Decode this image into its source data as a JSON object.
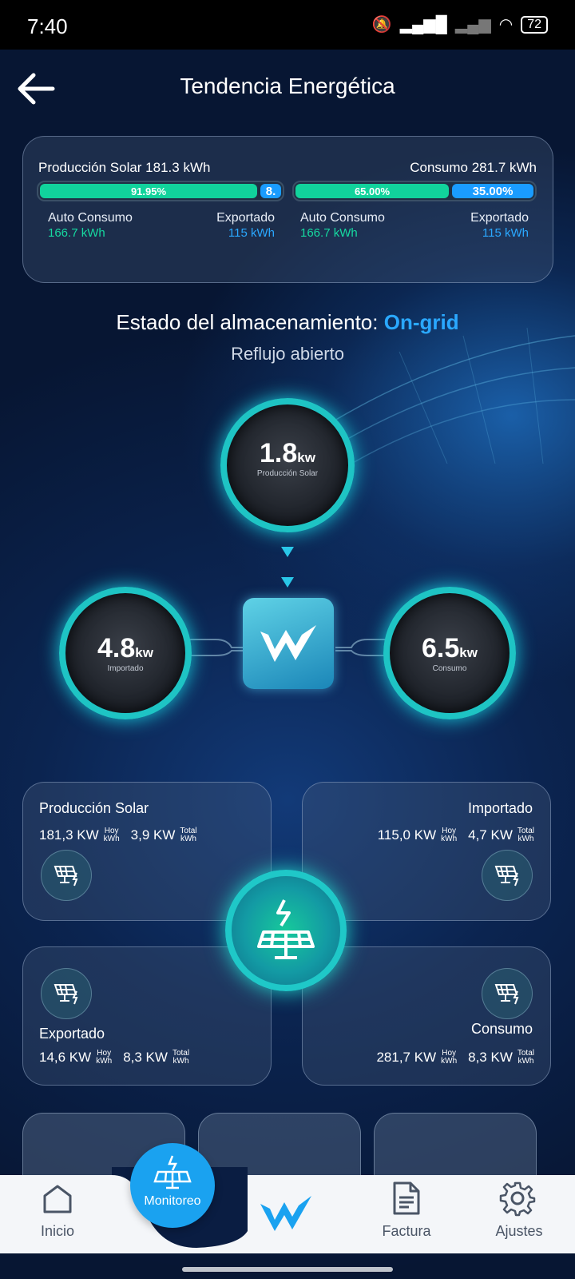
{
  "status": {
    "time": "7:40",
    "battery": "72"
  },
  "header": {
    "title": "Tendencia Energética"
  },
  "summary": {
    "solar_label": "Producción Solar 181.3 kWh",
    "consumo_label": "Consumo 281.7 kWh",
    "bar1": {
      "green_pct": "91.95%",
      "blue_pct": "8.",
      "green_fraction": 0.9195
    },
    "bar2": {
      "green_pct": "65.00%",
      "blue_pct": "35.00%",
      "green_fraction": 0.65
    },
    "left": {
      "auto_label": "Auto Consumo",
      "auto_value": "166.7 kWh",
      "exp_label": "Exportado",
      "exp_value": "115 kWh"
    },
    "right": {
      "auto_label": "Auto Consumo",
      "auto_value": "166.7 kWh",
      "exp_label": "Exportado",
      "exp_value": "115 kWh"
    }
  },
  "storage": {
    "prefix": "Estado del almacenamiento: ",
    "state": "On-grid",
    "sub": "Reflujo abierto"
  },
  "flow": {
    "solar": {
      "value": "1.8",
      "unit": "kw",
      "caption": "Producción Solar"
    },
    "import": {
      "value": "4.8",
      "unit": "kw",
      "caption": "Importado"
    },
    "consumo": {
      "value": "6.5",
      "unit": "kw",
      "caption": "Consumo"
    }
  },
  "cards": {
    "solar": {
      "title": "Producción Solar",
      "v1": "181,3 KW",
      "u1a": "Hoy",
      "u1b": "kWh",
      "v2": "3,9 KW",
      "u2a": "Total",
      "u2b": "kWh"
    },
    "import": {
      "title": "Importado",
      "v1": "115,0 KW",
      "u1a": "Hoy",
      "u1b": "kWh",
      "v2": "4,7 KW",
      "u2a": "Total",
      "u2b": "kWh"
    },
    "export": {
      "title": "Exportado",
      "v1": "14,6 KW",
      "u1a": "Hoy",
      "u1b": "kWh",
      "v2": "8,3 KW",
      "u2a": "Total",
      "u2b": "kWh"
    },
    "consumo": {
      "title": "Consumo",
      "v1": "281,7 KW",
      "u1a": "Hoy",
      "u1b": "kWh",
      "v2": "8,3 KW",
      "u2a": "Total",
      "u2b": "kWh"
    }
  },
  "nav": {
    "inicio": "Inicio",
    "monitoreo": "Monitoreo",
    "factura": "Factura",
    "ajustes": "Ajustes"
  },
  "colors": {
    "accent": "#1aa2f0",
    "green": "#11d39c",
    "ring": "#1ec4c4"
  }
}
